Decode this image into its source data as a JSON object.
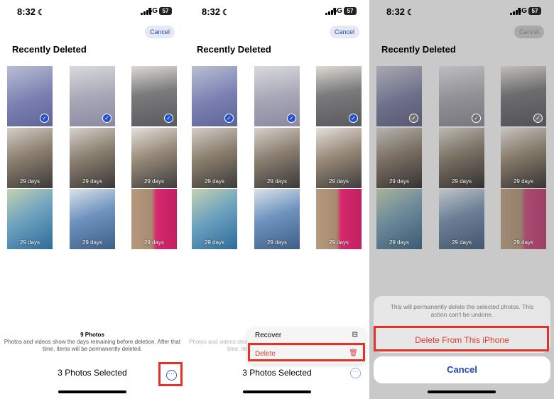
{
  "status": {
    "time": "8:32",
    "network": "5G",
    "battery": "57"
  },
  "header": {
    "cancel_label": "Cancel",
    "title": "Recently Deleted"
  },
  "photos": [
    {
      "label": "",
      "selected": true
    },
    {
      "label": "",
      "selected": true
    },
    {
      "label": "",
      "selected": true
    },
    {
      "label": "29 days",
      "selected": false
    },
    {
      "label": "29 days",
      "selected": false
    },
    {
      "label": "29 days",
      "selected": false
    },
    {
      "label": "29 days",
      "selected": false
    },
    {
      "label": "29 days",
      "selected": false
    },
    {
      "label": "29 days",
      "selected": false
    }
  ],
  "footer": {
    "count": "9 Photos",
    "note": "Photos and videos show the days remaining before deletion. After that time, items will be permanently deleted.",
    "selected_label": "3 Photos Selected"
  },
  "menu": {
    "recover_label": "Recover",
    "delete_label": "Delete"
  },
  "sheet": {
    "note": "This will permanently delete the selected photos. This action can't be undone.",
    "delete_label": "Delete From This iPhone",
    "cancel_label": "Cancel"
  },
  "colors": {
    "accent": "#1d49b5",
    "highlight": "#e53226",
    "destructive": "#dd3b31"
  }
}
